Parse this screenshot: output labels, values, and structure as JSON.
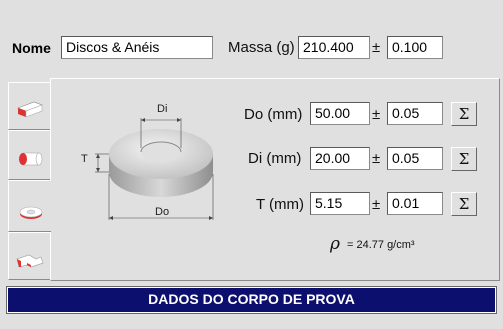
{
  "header": {
    "nome_label": "Nome",
    "nome_value": "Discos & Anéis",
    "massa_label": "Massa (g)",
    "massa_value": "210.400",
    "massa_pm": "±",
    "massa_tol": "0.100"
  },
  "tabs": [
    {
      "name": "block-shape-icon",
      "active": false
    },
    {
      "name": "cylinder-shape-icon",
      "active": false
    },
    {
      "name": "ring-shape-icon",
      "active": true
    },
    {
      "name": "irregular-shape-icon",
      "active": false
    }
  ],
  "diagram": {
    "di_label": "Di",
    "t_label": "T",
    "do_label": "Do"
  },
  "fields": {
    "do": {
      "label": "Do (mm)",
      "value": "50.00",
      "pm": "±",
      "tol": "0.05",
      "sigma": "Σ"
    },
    "di": {
      "label": "Di (mm)",
      "value": "20.00",
      "pm": "±",
      "tol": "0.05",
      "sigma": "Σ"
    },
    "t": {
      "label": "T (mm)",
      "value": "5.15",
      "pm": "±",
      "tol": "0.01",
      "sigma": "Σ"
    }
  },
  "density": {
    "symbol": "ρ",
    "text": "= 24.77 g/cm³"
  },
  "footer": {
    "title": "DADOS DO CORPO DE PROVA"
  }
}
